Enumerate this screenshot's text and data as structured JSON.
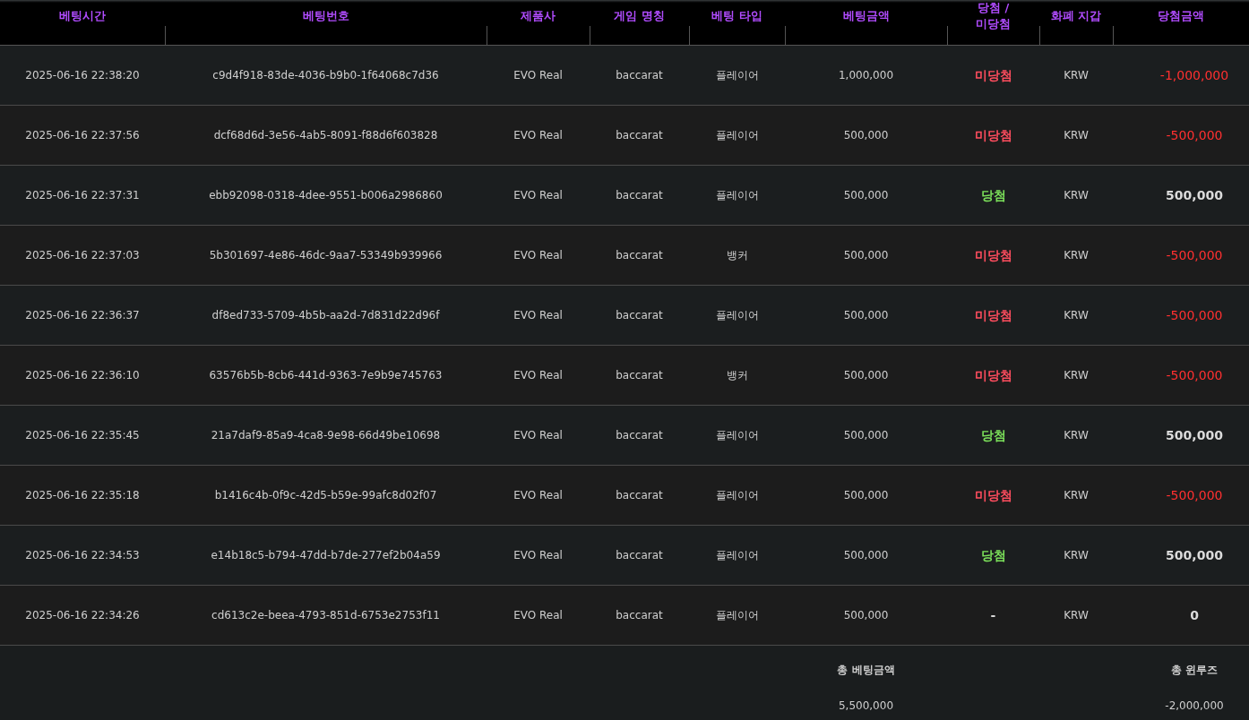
{
  "columns": [
    "베팅시간",
    "베팅번호",
    "제품사",
    "게임 명칭",
    "베팅 타입",
    "베팅금액",
    "당첨 /\n미당첨",
    "화폐 지갑",
    "당첨금액"
  ],
  "rows": [
    {
      "time": "2025-06-16 22:38:20",
      "id": "c9d4f918-83de-4036-b9b0-1f64068c7d36",
      "provider": "EVO Real",
      "game": "baccarat",
      "bet_type": "플레이어",
      "amount": "1,000,000",
      "result": "미당첨",
      "kind": "lose",
      "currency": "KRW",
      "payout": "-1,000,000"
    },
    {
      "time": "2025-06-16 22:37:56",
      "id": "dcf68d6d-3e56-4ab5-8091-f88d6f603828",
      "provider": "EVO Real",
      "game": "baccarat",
      "bet_type": "플레이어",
      "amount": "500,000",
      "result": "미당첨",
      "kind": "lose",
      "currency": "KRW",
      "payout": "-500,000"
    },
    {
      "time": "2025-06-16 22:37:31",
      "id": "ebb92098-0318-4dee-9551-b006a2986860",
      "provider": "EVO Real",
      "game": "baccarat",
      "bet_type": "플레이어",
      "amount": "500,000",
      "result": "당첨",
      "kind": "win",
      "currency": "KRW",
      "payout": "500,000"
    },
    {
      "time": "2025-06-16 22:37:03",
      "id": "5b301697-4e86-46dc-9aa7-53349b939966",
      "provider": "EVO Real",
      "game": "baccarat",
      "bet_type": "뱅커",
      "amount": "500,000",
      "result": "미당첨",
      "kind": "lose",
      "currency": "KRW",
      "payout": "-500,000"
    },
    {
      "time": "2025-06-16 22:36:37",
      "id": "df8ed733-5709-4b5b-aa2d-7d831d22d96f",
      "provider": "EVO Real",
      "game": "baccarat",
      "bet_type": "플레이어",
      "amount": "500,000",
      "result": "미당첨",
      "kind": "lose",
      "currency": "KRW",
      "payout": "-500,000"
    },
    {
      "time": "2025-06-16 22:36:10",
      "id": "63576b5b-8cb6-441d-9363-7e9b9e745763",
      "provider": "EVO Real",
      "game": "baccarat",
      "bet_type": "뱅커",
      "amount": "500,000",
      "result": "미당첨",
      "kind": "lose",
      "currency": "KRW",
      "payout": "-500,000"
    },
    {
      "time": "2025-06-16 22:35:45",
      "id": "21a7daf9-85a9-4ca8-9e98-66d49be10698",
      "provider": "EVO Real",
      "game": "baccarat",
      "bet_type": "플레이어",
      "amount": "500,000",
      "result": "당첨",
      "kind": "win",
      "currency": "KRW",
      "payout": "500,000"
    },
    {
      "time": "2025-06-16 22:35:18",
      "id": "b1416c4b-0f9c-42d5-b59e-99afc8d02f07",
      "provider": "EVO Real",
      "game": "baccarat",
      "bet_type": "플레이어",
      "amount": "500,000",
      "result": "미당첨",
      "kind": "lose",
      "currency": "KRW",
      "payout": "-500,000"
    },
    {
      "time": "2025-06-16 22:34:53",
      "id": "e14b18c5-b794-47dd-b7de-277ef2b04a59",
      "provider": "EVO Real",
      "game": "baccarat",
      "bet_type": "플레이어",
      "amount": "500,000",
      "result": "당첨",
      "kind": "win",
      "currency": "KRW",
      "payout": "500,000"
    },
    {
      "time": "2025-06-16 22:34:26",
      "id": "cd613c2e-beea-4793-851d-6753e2753f11",
      "provider": "EVO Real",
      "game": "baccarat",
      "bet_type": "플레이어",
      "amount": "500,000",
      "result": "-",
      "kind": "none",
      "currency": "KRW",
      "payout": "0"
    }
  ],
  "summary": {
    "total_bet_label": "총 베팅금액",
    "total_bet": "5,500,000",
    "total_winloss_label": "총 윈루즈",
    "total_winloss": "-2,000,000"
  }
}
